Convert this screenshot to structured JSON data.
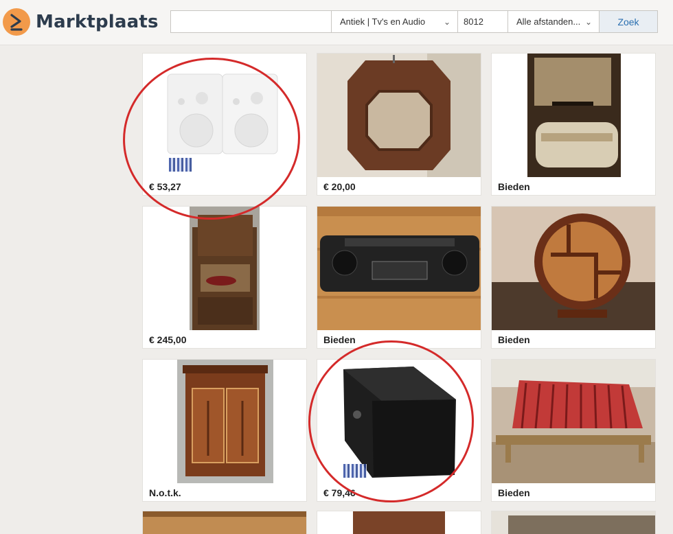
{
  "app": {
    "name": "Marktplaats"
  },
  "search": {
    "query": "",
    "category": "Antiek | Tv's en Audio",
    "zip": "8012",
    "distance": "Alle afstanden...",
    "button": "Zoek"
  },
  "listings": [
    {
      "price": "€ 53,27"
    },
    {
      "price": "€ 20,00"
    },
    {
      "price": "Bieden"
    },
    {
      "price": "€ 245,00"
    },
    {
      "price": "Bieden"
    },
    {
      "price": "Bieden"
    },
    {
      "price": "N.o.t.k."
    },
    {
      "price": "€ 79,46"
    },
    {
      "price": "Bieden"
    }
  ],
  "colors": {
    "brand": "#f29a4a",
    "annotation": "#d42a2a",
    "link": "#2a6fb0"
  }
}
